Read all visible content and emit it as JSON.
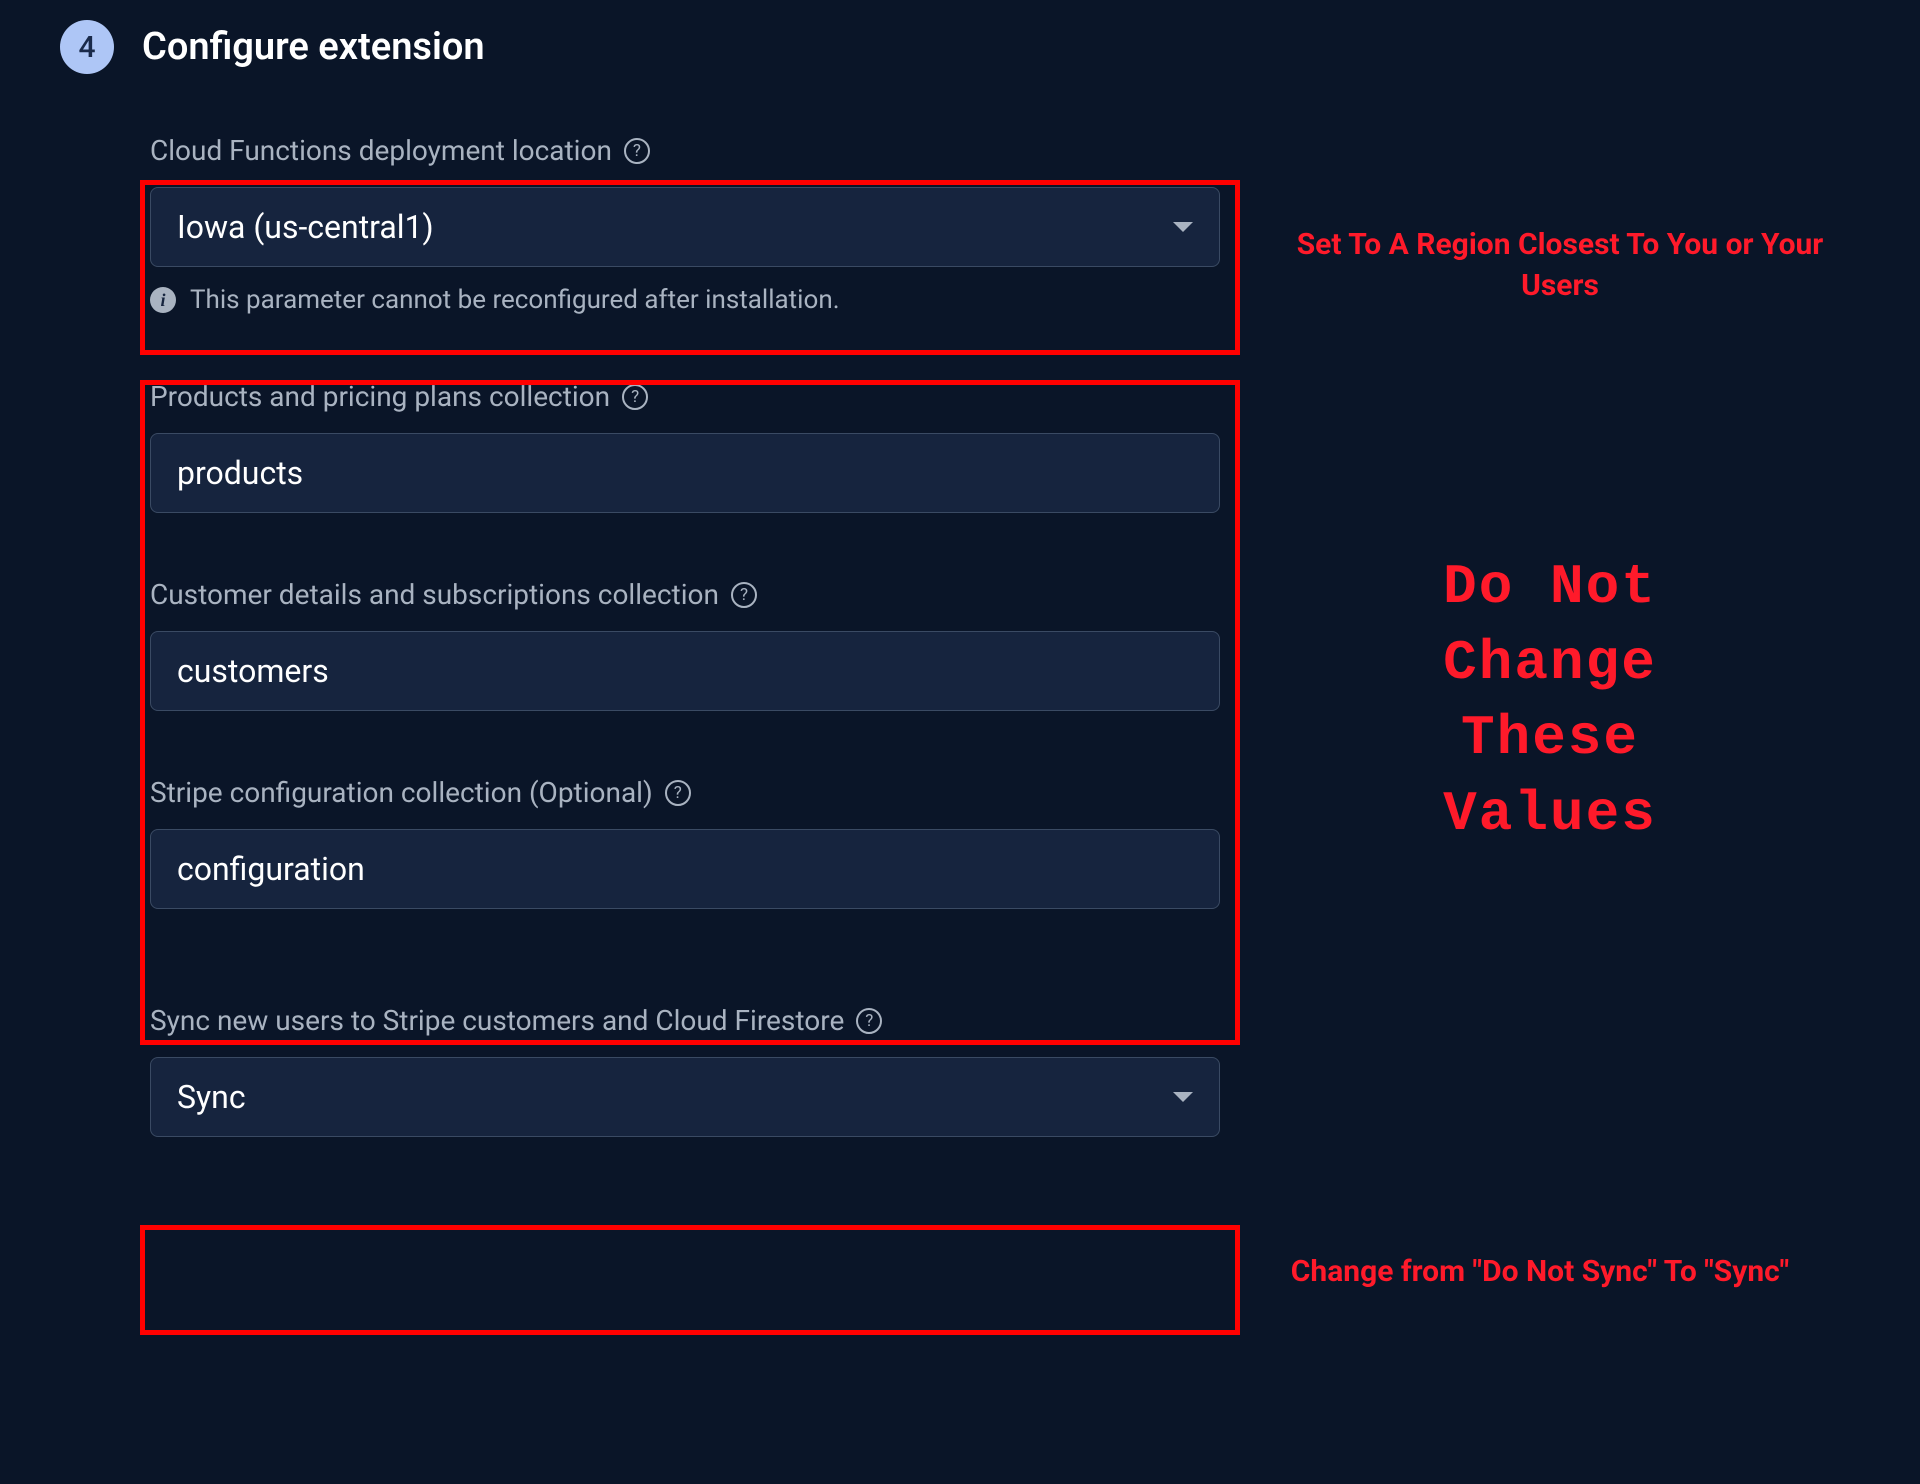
{
  "step_number": "4",
  "heading": "Configure extension",
  "fields": {
    "location": {
      "label": "Cloud Functions deployment location",
      "value": "Iowa (us-central1)",
      "info": "This parameter cannot be reconfigured after installation."
    },
    "products": {
      "label": "Products and pricing plans collection",
      "value": "products"
    },
    "customers": {
      "label": "Customer details and subscriptions collection",
      "value": "customers"
    },
    "stripe_config": {
      "label": "Stripe configuration collection (Optional)",
      "value": "configuration"
    },
    "sync": {
      "label": "Sync new users to Stripe customers and Cloud Firestore",
      "value": "Sync"
    }
  },
  "annotations": {
    "region": "Set To A Region Closest To You or Your Users",
    "no_change": "Do Not\nChange\nThese\nValues",
    "sync_note": "Change from \"Do Not Sync\" To \"Sync\""
  }
}
